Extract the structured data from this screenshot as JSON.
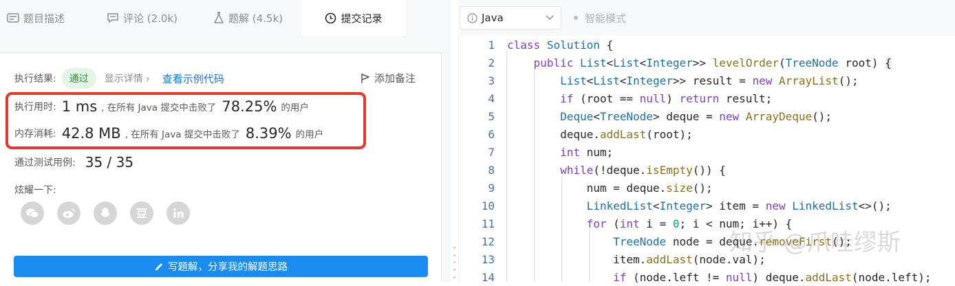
{
  "tabs": [
    {
      "label": "题目描述",
      "icon": "description-icon"
    },
    {
      "label": "评论 (2.0k)",
      "icon": "comment-icon"
    },
    {
      "label": "题解 (4.5k)",
      "icon": "flask-icon"
    },
    {
      "label": "提交记录",
      "icon": "clock-icon"
    }
  ],
  "result": {
    "label": "执行结果:",
    "status": "通过",
    "details": "显示详情 ›",
    "example_link": "查看示例代码",
    "add_note": "添加备注",
    "time_label": "执行用时:",
    "time_value": "1 ms",
    "time_mid": ", 在所有 Java 提交中击败了",
    "time_pct": "78.25%",
    "time_tail": "的用户",
    "mem_label": "内存消耗:",
    "mem_value": "42.8 MB",
    "mem_mid": ", 在所有 Java 提交中击败了",
    "mem_pct": "8.39%",
    "mem_tail": "的用户",
    "tests_label": "通过测试用例:",
    "tests_value": "35 / 35",
    "share_label": "炫耀一下:",
    "share_icons": [
      "wechat-icon",
      "weibo-icon",
      "qq-icon",
      "douban-icon",
      "linkedin-icon"
    ],
    "write_button": "写题解，分享我的解题思路"
  },
  "editor": {
    "language": "Java",
    "mode": "智能模式",
    "line_numbers": [
      "1",
      "2",
      "3",
      "4",
      "5",
      "6",
      "7",
      "8",
      "9",
      "10",
      "11",
      "12",
      "13",
      "14"
    ],
    "watermark": "知乎 @爪哇缪斯"
  },
  "colors": {
    "accent": "#1a8cf0",
    "success_bg": "#e3f6e6",
    "success": "#2d8f3f",
    "highlight": "#e8362b"
  }
}
